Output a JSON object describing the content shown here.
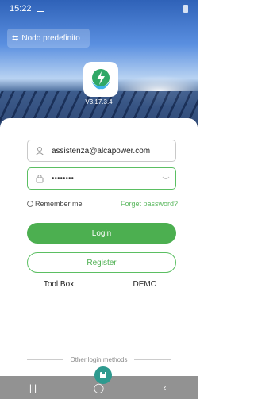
{
  "status_bar": {
    "time": "15:22"
  },
  "header": {
    "node_button_label": "Nodo predefinito",
    "version": "V3.17.3.4"
  },
  "login": {
    "email_value": "assistenza@alcapower.com",
    "password_masked": "••••••••",
    "remember_me_label": "Remember me",
    "forget_password_label": "Forget password?",
    "login_label": "Login",
    "register_label": "Register",
    "toolbox_label": "Tool Box",
    "demo_label": "DEMO",
    "other_methods_label": "Other login methods"
  },
  "colors": {
    "accent": "#4caf50",
    "nav_bar": "#929292"
  },
  "icons": [
    "image-icon",
    "battery-icon",
    "swap-icon",
    "app-logo-icon",
    "user-icon",
    "lock-icon",
    "eye-icon",
    "recent-apps-icon",
    "home-icon",
    "back-icon"
  ]
}
